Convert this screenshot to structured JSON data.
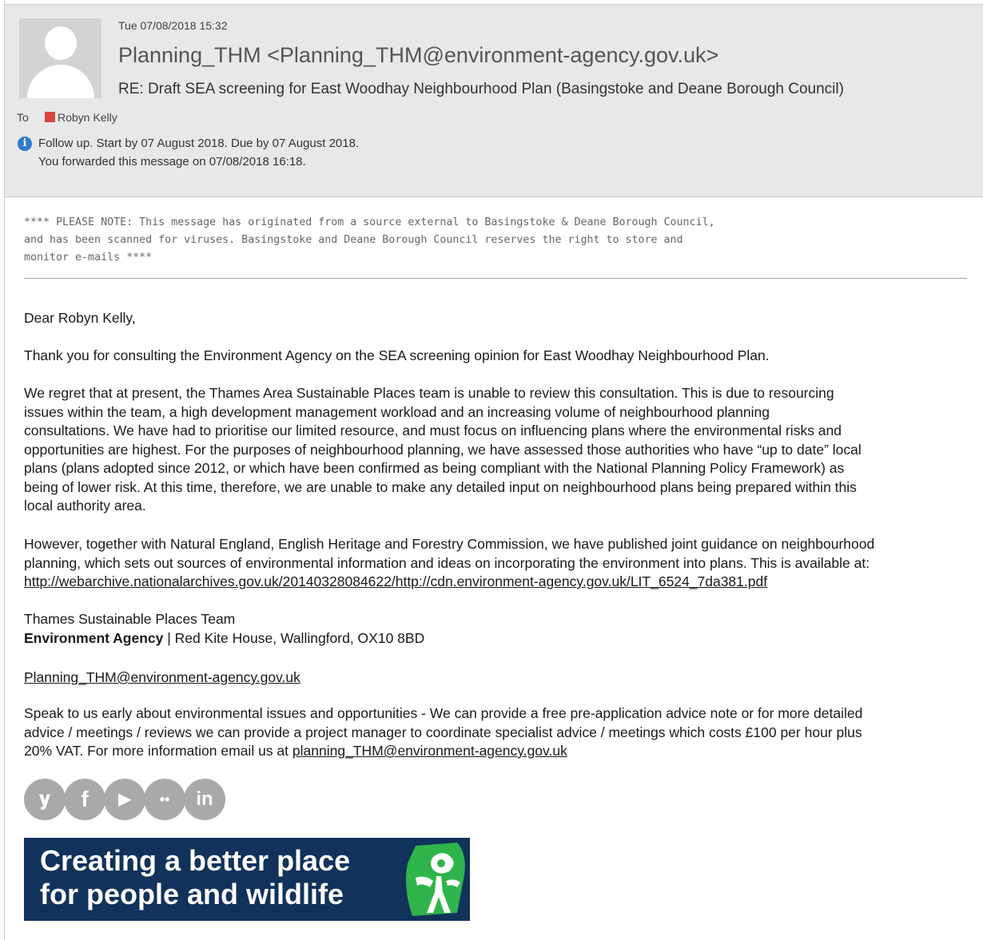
{
  "header": {
    "date": "Tue 07/08/2018 15:32",
    "sender": "Planning_THM <Planning_THM@environment-agency.gov.uk>",
    "subject": "RE: Draft SEA screening for East Woodhay Neighbourhood Plan  (Basingstoke and Deane Borough Council)",
    "to_label": "To",
    "to_name": "Robyn Kelly",
    "followup": "Follow up.  Start by 07 August 2018.  Due by 07 August 2018.",
    "forwarded": "You forwarded this message on 07/08/2018 16:18."
  },
  "notice": "**** PLEASE NOTE: This message has originated from a source external to Basingstoke & Deane Borough Council,\nand has been scanned for viruses. Basingstoke and Deane Borough Council reserves the right to store and\nmonitor e-mails ****",
  "body": {
    "greeting": "Dear Robyn Kelly,",
    "para1": "Thank you for consulting the Environment Agency on the SEA screening opinion for East Woodhay Neighbourhood Plan.",
    "para2_lines": [
      "We regret that at present, the Thames Area Sustainable Places team is unable to review this consultation.  This is due to resourcing",
      "issues within the team, a high development management workload and an increasing volume of neighbourhood planning",
      "consultations.  We have had to prioritise our limited resource, and must focus on influencing plans where the environmental risks and",
      "opportunities are highest.  For the purposes of neighbourhood planning, we have assessed those authorities who have “up to date” local",
      "plans (plans adopted since 2012, or which have been confirmed as being compliant with the National Planning Policy Framework) as",
      "being of lower risk.  At this time, therefore, we are unable to make any detailed input on neighbourhood plans being prepared within this",
      "local authority area."
    ],
    "para3_lines": [
      "However, together with Natural England, English Heritage and Forestry Commission, we have published joint guidance on neighbourhood",
      "planning, which sets out sources of environmental information and ideas on incorporating the environment into plans.  This is available at:"
    ],
    "guidance_link": "http://webarchive.nationalarchives.gov.uk/20140328084622/http://cdn.environment-agency.gov.uk/LIT_6524_7da381.pdf",
    "sig_team": "Thames Sustainable Places Team",
    "sig_org": "Environment Agency",
    "sig_address": " | Red Kite House, Wallingford, OX10 8BD",
    "sig_email": "Planning_THM@environment-agency.gov.uk",
    "para4_lines": [
      "Speak to us early about environmental issues and opportunities - We can provide a free pre-application advice note or for more detailed",
      "advice / meetings / reviews we can provide a project manager to coordinate specialist advice / meetings which costs £100 per hour plus"
    ],
    "para4_last": "20% VAT.  For more information email us at ",
    "para4_email": "planning_THM@environment-agency.gov.uk"
  },
  "social": {
    "twitter": "𝐲",
    "facebook": "f",
    "youtube": "▶",
    "flickr": "••",
    "linkedin": "in"
  },
  "banner": {
    "line1": "Creating a better place",
    "line2": "for people and wildlife"
  },
  "colors": {
    "banner_bg": "#10325b",
    "logo_green": "#2fb44b",
    "header_bg": "#e8e8e8"
  }
}
